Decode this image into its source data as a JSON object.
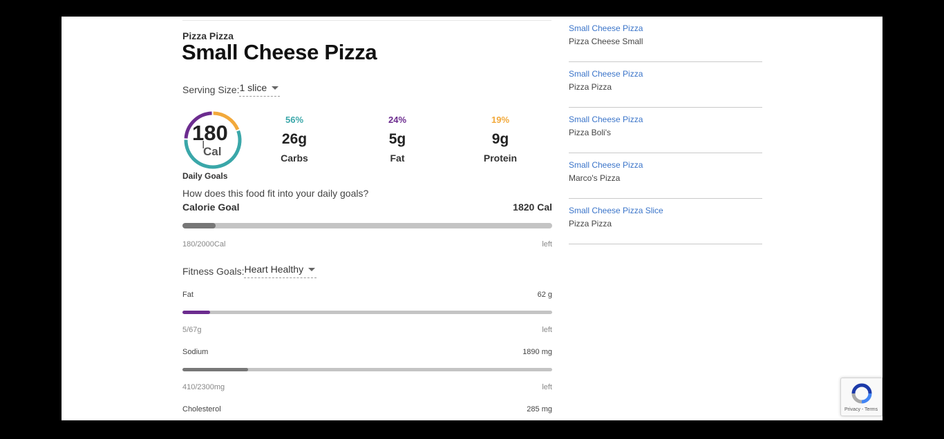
{
  "food": {
    "brand": "Pizza Pizza",
    "title": "Small Cheese Pizza",
    "serving_label": "Serving Size:",
    "serving_value": "1 slice"
  },
  "calories": {
    "value": "180",
    "unit": "Cal",
    "daily_goals_label": "Daily Goals",
    "carbs_fraction": 0.56,
    "fat_fraction": 0.24,
    "protein_fraction": 0.19
  },
  "macros": [
    {
      "pct": "56%",
      "grams": "26g",
      "label": "Carbs",
      "color": "#3aa7a9"
    },
    {
      "pct": "24%",
      "grams": "5g",
      "label": "Fat",
      "color": "#6c2c8f"
    },
    {
      "pct": "19%",
      "grams": "9g",
      "label": "Protein",
      "color": "#f2a93b"
    }
  ],
  "goals": {
    "question": "How does this food fit into your daily goals?",
    "calorie_goal_label": "Calorie Goal",
    "calorie_goal_value": "1820 Cal",
    "calorie_progress_text": "180/2000Cal",
    "calorie_left": "left",
    "calorie_fraction": 0.09
  },
  "fitness": {
    "label": "Fitness Goals:",
    "value": "Heart Healthy",
    "items": [
      {
        "name": "Fat",
        "remaining": "62 g",
        "progress_text": "5/67g",
        "left": "left",
        "fraction": 0.075,
        "color": "#6c2c8f"
      },
      {
        "name": "Sodium",
        "remaining": "1890 mg",
        "progress_text": "410/2300mg",
        "left": "left",
        "fraction": 0.178,
        "color": "#777777"
      },
      {
        "name": "Cholesterol",
        "remaining": "285 mg"
      }
    ]
  },
  "sidebar": {
    "items": [
      {
        "link": "Small Cheese Pizza",
        "sub": "Pizza Cheese Small"
      },
      {
        "link": "Small Cheese Pizza",
        "sub": "Pizza Pizza"
      },
      {
        "link": "Small Cheese Pizza",
        "sub": "Pizza Boli's"
      },
      {
        "link": "Small Cheese Pizza",
        "sub": "Marco's Pizza"
      },
      {
        "link": "Small Cheese Pizza Slice",
        "sub": "Pizza Pizza"
      }
    ]
  },
  "recaptcha": {
    "terms": "Privacy - Terms"
  },
  "colors": {
    "link": "#3a74c9",
    "calorie_bar": "#777777"
  }
}
